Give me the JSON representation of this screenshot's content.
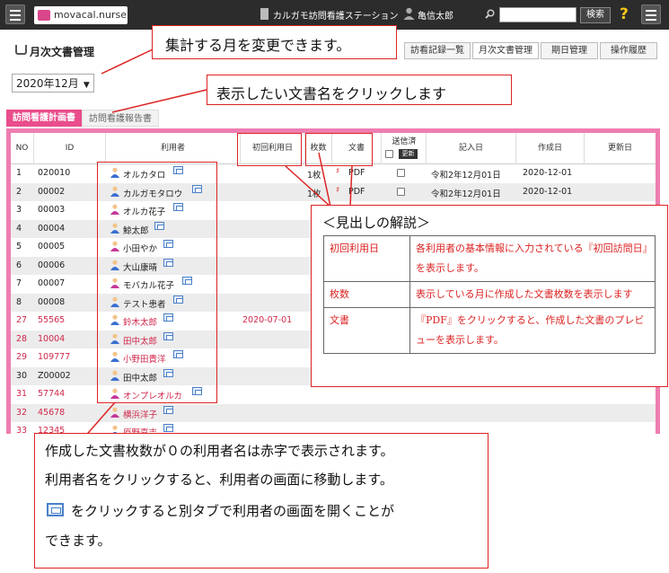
{
  "header": {
    "app_name": "movacal.nurse",
    "office_name": "カルガモ訪問看護ステーション",
    "user_name": "亀信太郎",
    "search_placeholder": "",
    "search_button": "検索",
    "help_icon": "?",
    "menu_icon": "hamburger-icon"
  },
  "page": {
    "title": "月次文書管理",
    "month_select": "2020年12月",
    "nav_tabs": [
      {
        "label": "訪看記録一覧",
        "active": false
      },
      {
        "label": "月次文書管理",
        "active": true
      },
      {
        "label": "期日管理",
        "active": false
      },
      {
        "label": "操作履歴",
        "active": false
      }
    ],
    "doc_tabs": [
      {
        "label": "訪問看護計画書",
        "active": true
      },
      {
        "label": "訪問看護報告書",
        "active": false
      }
    ]
  },
  "table": {
    "columns": [
      "NO",
      "ID",
      "利用者",
      "初回利用日",
      "枚数",
      "文書",
      "送信済",
      "記入日",
      "作成日",
      "更新日"
    ],
    "update_button": "更新",
    "rows": [
      {
        "no": "1",
        "id": "020010",
        "name": "オルカタロ",
        "gender": "m",
        "first": "",
        "count": "1枚",
        "doc": "PDF",
        "entry": "令和2年12月01日",
        "created": "2020-12-01",
        "red": false
      },
      {
        "no": "2",
        "id": "00002",
        "name": "カルガモタロウ",
        "gender": "m",
        "first": "",
        "count": "1枚",
        "doc": "PDF",
        "entry": "令和2年12月01日",
        "created": "2020-12-01",
        "red": false
      },
      {
        "no": "3",
        "id": "00003",
        "name": "オルカ花子",
        "gender": "f",
        "first": "",
        "count": "",
        "doc": "",
        "entry": "",
        "created": "",
        "red": false
      },
      {
        "no": "4",
        "id": "00004",
        "name": "鯨太郎",
        "gender": "m",
        "first": "",
        "count": "",
        "doc": "",
        "entry": "",
        "created": "",
        "red": false
      },
      {
        "no": "5",
        "id": "00005",
        "name": "小田やか",
        "gender": "f",
        "first": "",
        "count": "",
        "doc": "",
        "entry": "",
        "created": "",
        "red": false
      },
      {
        "no": "6",
        "id": "00006",
        "name": "大山康晴",
        "gender": "m",
        "first": "",
        "count": "",
        "doc": "",
        "entry": "",
        "created": "",
        "red": false
      },
      {
        "no": "7",
        "id": "00007",
        "name": "モバカル花子",
        "gender": "f",
        "first": "",
        "count": "",
        "doc": "",
        "entry": "",
        "created": "",
        "red": false
      },
      {
        "no": "8",
        "id": "00008",
        "name": "テスト患者",
        "gender": "m",
        "first": "",
        "count": "",
        "doc": "",
        "entry": "",
        "created": "",
        "red": false
      },
      {
        "no": "27",
        "id": "55565",
        "name": "鈴木太郎",
        "gender": "m",
        "first": "2020-07-01",
        "count": "",
        "doc": "",
        "entry": "",
        "created": "",
        "red": true
      },
      {
        "no": "28",
        "id": "10004",
        "name": "田中太郎",
        "gender": "m",
        "first": "",
        "count": "",
        "doc": "",
        "entry": "",
        "created": "",
        "red": true
      },
      {
        "no": "29",
        "id": "109777",
        "name": "小野田貴洋",
        "gender": "m",
        "first": "",
        "count": "",
        "doc": "",
        "entry": "",
        "created": "",
        "red": true
      },
      {
        "no": "30",
        "id": "Z00002",
        "name": "田中太郎",
        "gender": "m",
        "first": "",
        "count": "",
        "doc": "",
        "entry": "",
        "created": "",
        "red": false
      },
      {
        "no": "31",
        "id": "57744",
        "name": "オンプレオルカ",
        "gender": "f",
        "first": "",
        "count": "",
        "doc": "",
        "entry": "",
        "created": "",
        "red": true
      },
      {
        "no": "32",
        "id": "45678",
        "name": "横浜洋子",
        "gender": "f",
        "first": "",
        "count": "",
        "doc": "",
        "entry": "",
        "created": "",
        "red": true
      },
      {
        "no": "33",
        "id": "12345",
        "name": "原野嘉吉",
        "gender": "m",
        "first": "",
        "count": "",
        "doc": "",
        "entry": "",
        "created": "",
        "red": true
      }
    ]
  },
  "annotations": {
    "month_note": "集計する月を変更できます。",
    "docname_note": "表示したい文書名をクリックします",
    "legend_title": "＜見出しの解説＞",
    "legend": [
      {
        "term": "初回利用日",
        "desc": "各利用者の基本情報に入力されている『初回訪問日』を表示します。"
      },
      {
        "term": "枚数",
        "desc": "表示している月に作成した文書枚数を表示します"
      },
      {
        "term": "文書",
        "desc": "『PDF』をクリックすると、作成した文書のプレビューを表示します。"
      }
    ],
    "bottom_line1": "作成した文書枚数が０の利用者名は赤字で表示されます。",
    "bottom_line2": "利用者名をクリックすると、利用者の画面に移動します。",
    "bottom_line3": "をクリックすると別タブで利用者の画面を開くことが",
    "bottom_line4": "できます。"
  },
  "colors": {
    "accent": "#e94d8c",
    "annotation": "#dd2222",
    "header_bg": "#2c2c2c",
    "red_text": "#d0284a"
  }
}
